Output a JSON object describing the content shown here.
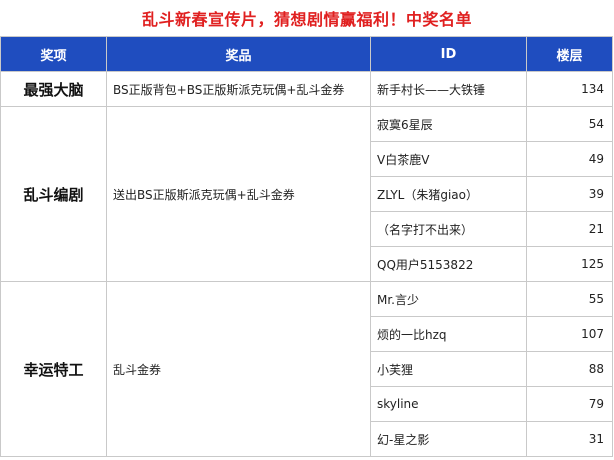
{
  "title": "乱斗新春宣传片，猜想剧情赢福利！中奖名单",
  "header": {
    "award": "奖项",
    "prize": "奖品",
    "id": "ID",
    "floor": "楼层"
  },
  "groups": [
    {
      "award": "最强大脑",
      "prize": "BS正版背包+BS正版斯派克玩偶+乱斗金券",
      "winners": [
        {
          "id": "新手村长——大铁锤",
          "floor": "134"
        }
      ]
    },
    {
      "award": "乱斗编剧",
      "prize": "送出BS正版斯派克玩偶+乱斗金券",
      "winners": [
        {
          "id": "寂寞6星辰",
          "floor": "54"
        },
        {
          "id": "V白茶鹿V",
          "floor": "49"
        },
        {
          "id": "ZLYL（朱猪giao）",
          "floor": "39"
        },
        {
          "id": "（名字打不出来）",
          "floor": "21"
        },
        {
          "id": "QQ用户5153822",
          "floor": "125"
        }
      ]
    },
    {
      "award": "幸运特工",
      "prize": "乱斗金券",
      "winners": [
        {
          "id": "Mr.言少",
          "floor": "55"
        },
        {
          "id": "烦的一比hzq",
          "floor": "107"
        },
        {
          "id": "小芙狸",
          "floor": "88"
        },
        {
          "id": "skyline",
          "floor": "79"
        },
        {
          "id": "幻-星之影",
          "floor": "31"
        }
      ]
    }
  ]
}
